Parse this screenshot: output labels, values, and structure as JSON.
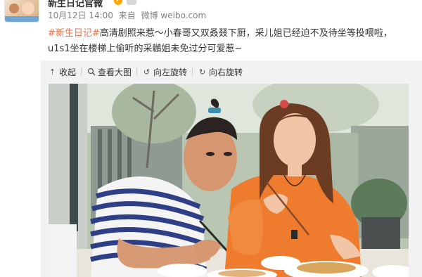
{
  "post": {
    "user_name": "新生日记官微",
    "time": "10月12日 14:00",
    "from_label": "来自",
    "source": "微博 weibo.com",
    "hashtag": "#新生日记#",
    "text": "高清剧照来惹～小春哥又双叒叕下厨，采儿姐已经迫不及待坐等投喂啦，u1s1坐在楼梯上偷听的采鶒姐未免过分可爱惹~"
  },
  "toolbar": {
    "collapse_label": "收起",
    "view_large_label": "查看大图",
    "rotate_left_label": "向左旋转",
    "rotate_right_label": "向右旋转"
  },
  "icons": {
    "collapse": "collapse-up-icon",
    "view_large": "magnify-icon",
    "rotate_left": "rotate-left-icon",
    "rotate_right": "rotate-right-icon",
    "verified": "vip-badge-icon"
  },
  "colors": {
    "hashtag": "#eb7350",
    "meta": "#808080",
    "panel": "#f2f2f5"
  }
}
